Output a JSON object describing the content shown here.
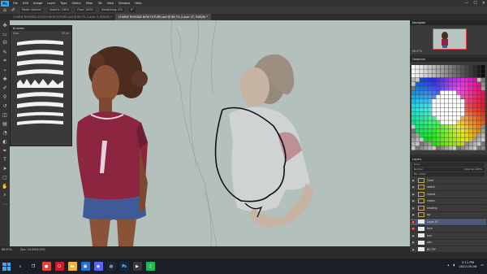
{
  "app": {
    "logo": "Ps"
  },
  "menubar": {
    "items": [
      "File",
      "Edit",
      "Image",
      "Layer",
      "Type",
      "Select",
      "Filter",
      "3D",
      "View",
      "Window",
      "Help"
    ]
  },
  "window_controls": {
    "minimize": "—",
    "maximize": "☐",
    "close": "✕"
  },
  "options": {
    "mode": "Mode: Normal",
    "opacity": "Opacity: 100%",
    "flow": "Flow: 100%",
    "smoothing": "Smoothing: 0%",
    "angle": "0°"
  },
  "tabs": [
    {
      "label": "CHARIE RHONDA S47620 NEW FUTURE.psd @ 66.7% (Layer 3, RGB/8) *",
      "active": false
    },
    {
      "label": "CHARIE RHONDA NEW FUTURE.psd @ 66.7% (Layer 47, RGB/8) *",
      "active": true
    }
  ],
  "tools": [
    {
      "icon": "move-icon",
      "glyph": "✥"
    },
    {
      "icon": "marquee-icon",
      "glyph": "▭"
    },
    {
      "icon": "lasso-icon",
      "glyph": "ᘏ"
    },
    {
      "icon": "quick-select-icon",
      "glyph": "✎"
    },
    {
      "icon": "crop-icon",
      "glyph": "⌗"
    },
    {
      "icon": "eyedropper-icon",
      "glyph": "⌁"
    },
    {
      "icon": "healing-icon",
      "glyph": "✚"
    },
    {
      "icon": "brush-icon",
      "glyph": "✐"
    },
    {
      "icon": "stamp-icon",
      "glyph": "⚲"
    },
    {
      "icon": "history-brush-icon",
      "glyph": "↺"
    },
    {
      "icon": "eraser-icon",
      "glyph": "◫"
    },
    {
      "icon": "gradient-icon",
      "glyph": "▤"
    },
    {
      "icon": "blur-icon",
      "glyph": "◔"
    },
    {
      "icon": "dodge-icon",
      "glyph": "◐"
    },
    {
      "icon": "pen-icon",
      "glyph": "✒"
    },
    {
      "icon": "type-icon",
      "glyph": "T"
    },
    {
      "icon": "path-select-icon",
      "glyph": "➤"
    },
    {
      "icon": "shape-icon",
      "glyph": "▢"
    },
    {
      "icon": "hand-icon",
      "glyph": "✋"
    },
    {
      "icon": "zoom-icon",
      "glyph": "⌕"
    },
    {
      "icon": "more-tools-icon",
      "glyph": "⋯"
    }
  ],
  "brushes": {
    "title": "Brushes",
    "size_label": "Size:",
    "size_value": "52 px",
    "folder": "Gouache"
  },
  "status": {
    "zoom": "66.67%",
    "doc": "Doc: 10.5M/6.02G"
  },
  "navigator": {
    "title": "Navigator",
    "zoom": "66.67%"
  },
  "swatches": {
    "title": "Swatches"
  },
  "layers": {
    "title": "Layers",
    "kind": "Kind",
    "blend": "Normal",
    "opacity": "Opacity: 100%",
    "fill": "Fill: 100%",
    "items": [
      {
        "name": "Color",
        "type": "folder",
        "active": false,
        "red": false
      },
      {
        "name": "sketch",
        "type": "folder",
        "active": false,
        "red": false
      },
      {
        "name": "lineart",
        "type": "folder",
        "active": false,
        "red": false
      },
      {
        "name": "colors",
        "type": "folder",
        "active": false,
        "red": false
      },
      {
        "name": "shading",
        "type": "folder",
        "active": false,
        "red": false
      },
      {
        "name": "bg",
        "type": "folder",
        "active": false,
        "red": false
      },
      {
        "name": "Layer 47",
        "type": "layer",
        "active": true,
        "red": true
      },
      {
        "name": "face",
        "type": "layer",
        "active": false,
        "red": true
      },
      {
        "name": "hair",
        "type": "layer",
        "active": false,
        "red": false
      },
      {
        "name": "skin",
        "type": "layer",
        "active": false,
        "red": false
      },
      {
        "name": "BG FFF",
        "type": "layer",
        "active": false,
        "red": false
      },
      {
        "name": "Layer 21",
        "type": "layer",
        "active": false,
        "red": false
      },
      {
        "name": "Layer 1",
        "type": "layer",
        "active": false,
        "red": false
      }
    ]
  },
  "taskbar": {
    "apps": [
      {
        "icon": "search-icon",
        "glyph": "⌕",
        "color": "#1b1e26"
      },
      {
        "icon": "task-view-icon",
        "glyph": "❐",
        "color": "#1b1e26"
      },
      {
        "icon": "chrome-icon",
        "glyph": "●",
        "color": "#d9453a"
      },
      {
        "icon": "opera-icon",
        "glyph": "O",
        "color": "#cc1b2b"
      },
      {
        "icon": "explorer-icon",
        "glyph": "▬",
        "color": "#e9b73e"
      },
      {
        "icon": "store-icon",
        "glyph": "▣",
        "color": "#2a6fd0"
      },
      {
        "icon": "discord-icon",
        "glyph": "◉",
        "color": "#5865f2"
      },
      {
        "icon": "steam-icon",
        "glyph": "◍",
        "color": "#1b2838"
      },
      {
        "icon": "photoshop-icon",
        "glyph": "Ps",
        "color": "#0f2a45"
      },
      {
        "icon": "media-icon",
        "glyph": "▶",
        "color": "#3a3a3a"
      },
      {
        "icon": "spotify-icon",
        "glyph": "♫",
        "color": "#1db954"
      }
    ],
    "time": "2:11 PM",
    "date": "2022-05-06"
  }
}
